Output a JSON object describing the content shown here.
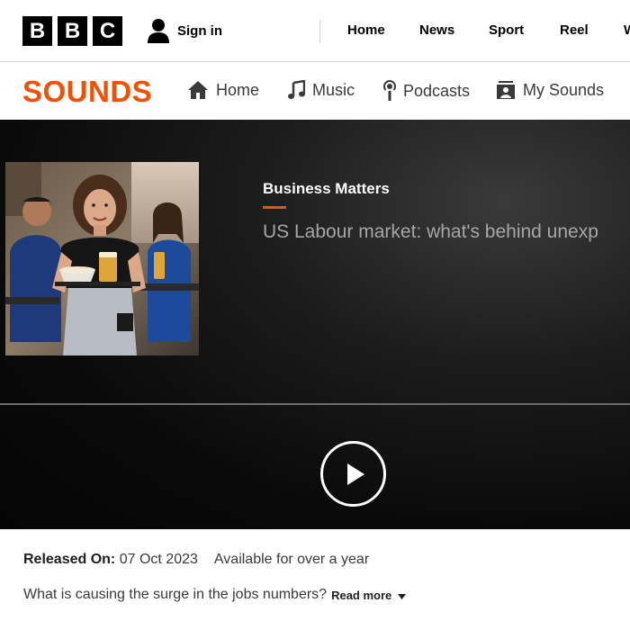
{
  "bbc": {
    "logo_letters": [
      "B",
      "B",
      "C"
    ],
    "sign_in": "Sign in",
    "nav": [
      "Home",
      "News",
      "Sport",
      "Reel",
      "W"
    ]
  },
  "sounds": {
    "logo": "SOUNDS",
    "nav": {
      "home": "Home",
      "music": "Music",
      "podcasts": "Podcasts",
      "my_sounds": "My Sounds"
    },
    "accent": "#f54f00"
  },
  "episode": {
    "brand": "Business Matters",
    "title": "US Labour market: what's behind unexp",
    "released_label": "Released On:",
    "released_date": "07 Oct 2023",
    "availability": "Available for over a year",
    "description": "What is causing the surge in the jobs numbers?",
    "read_more": "Read more"
  },
  "icons": [
    "user-icon",
    "home-icon",
    "music-note-icon",
    "podcast-icon",
    "my-sounds-icon",
    "play-icon",
    "chevron-down-icon"
  ]
}
